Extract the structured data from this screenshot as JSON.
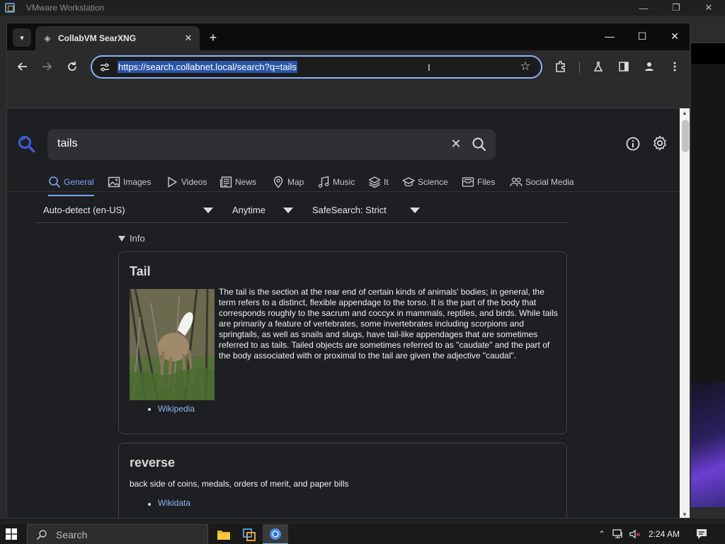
{
  "vmware": {
    "title": "VMware Workstation",
    "controls": [
      "—",
      "❐",
      "✕"
    ]
  },
  "browser": {
    "tab": {
      "title": "CollabVM SearXNG"
    },
    "window_controls": [
      "—",
      "☐",
      "✕"
    ],
    "address": "https://search.collabnet.local/search?q=tails"
  },
  "search": {
    "query": "tails"
  },
  "categories": [
    {
      "label": "General",
      "icon": "search-icon",
      "active": true
    },
    {
      "label": "Images",
      "icon": "image-icon"
    },
    {
      "label": "Videos",
      "icon": "play-icon"
    },
    {
      "label": "News",
      "icon": "newspaper-icon"
    },
    {
      "label": "Map",
      "icon": "map-pin-icon"
    },
    {
      "label": "Music",
      "icon": "music-note-icon"
    },
    {
      "label": "It",
      "icon": "layers-icon"
    },
    {
      "label": "Science",
      "icon": "graduation-cap-icon"
    },
    {
      "label": "Files",
      "icon": "archive-icon"
    },
    {
      "label": "Social Media",
      "icon": "people-icon"
    }
  ],
  "filters": {
    "language": "Auto-detect (en-US)",
    "time": "Anytime",
    "safesearch": "SafeSearch: Strict"
  },
  "info_label": "Info",
  "infobox": {
    "title": "Tail",
    "text": "The tail is the section at the rear end of certain kinds of animals' bodies; in general, the term refers to a distinct, flexible appendage to the torso. It is the part of the body that corresponds roughly to the sacrum and coccyx in mammals, reptiles, and birds. While tails are primarily a feature of vertebrates, some invertebrates including scorpions and springtails, as well as snails and slugs, have tail-like appendages that are sometimes referred to as tails. Tailed objects are sometimes referred to as \"caudate\" and the part of the body associated with or proximal to the tail are given the adjective \"caudal\".",
    "link": "Wikipedia"
  },
  "infobox2": {
    "title": "reverse",
    "text": "back side of coins, medals, orders of merit, and paper bills",
    "link": "Wikidata"
  },
  "taskbar": {
    "search_placeholder": "Search",
    "time": "2:24 AM"
  },
  "colors": {
    "accent": "#7aa2ff",
    "link": "#8ab4f8",
    "url_highlight": "#2a55a8"
  }
}
